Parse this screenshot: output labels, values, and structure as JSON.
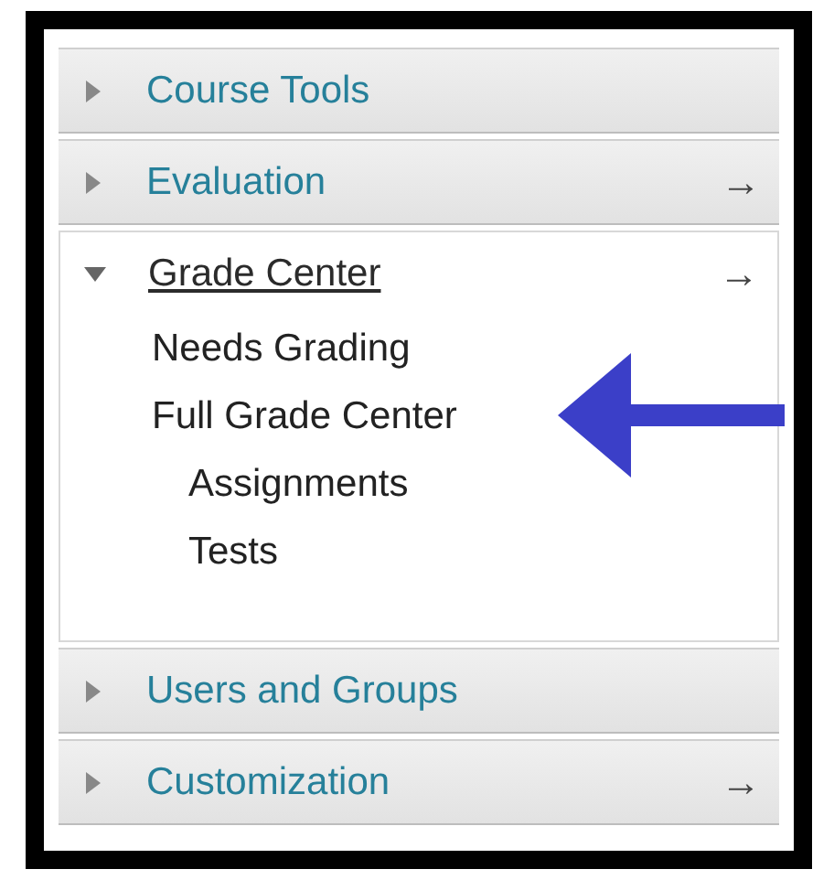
{
  "menu": [
    {
      "label": "Course Tools",
      "expanded": false
    },
    {
      "label": "Evaluation",
      "expanded": false,
      "link_arrow": "→"
    },
    {
      "label": "Grade Center",
      "expanded": true,
      "link_arrow": "→",
      "children": [
        {
          "label": "Needs Grading",
          "pointed": false
        },
        {
          "label": "Full Grade Center",
          "pointed": true,
          "children": [
            {
              "label": "Assignments"
            },
            {
              "label": "Tests"
            }
          ]
        }
      ]
    },
    {
      "label": "Users and Groups",
      "expanded": false
    },
    {
      "label": "Customization",
      "expanded": false,
      "link_arrow": "→"
    }
  ]
}
